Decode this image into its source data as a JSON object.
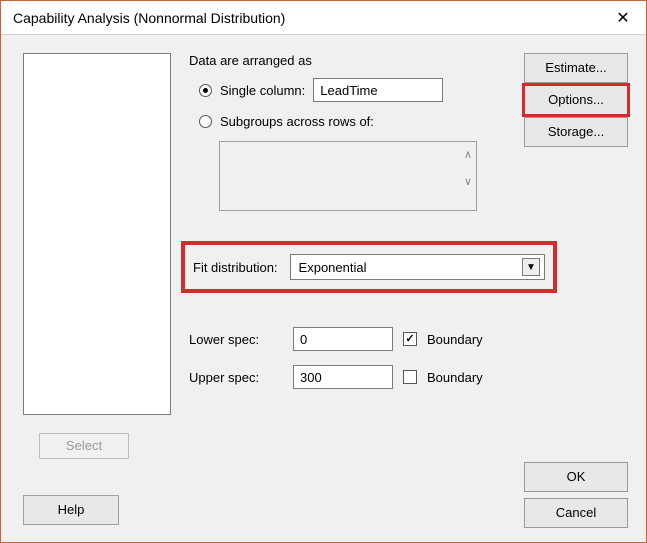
{
  "window": {
    "title": "Capability Analysis (Nonnormal Distribution)"
  },
  "buttons": {
    "estimate": "Estimate...",
    "options": "Options...",
    "storage": "Storage...",
    "select": "Select",
    "help": "Help",
    "ok": "OK",
    "cancel": "Cancel"
  },
  "form": {
    "arranged_label": "Data are arranged as",
    "single_column_label": "Single column:",
    "single_column_value": "LeadTime",
    "subgroups_label": "Subgroups across rows of:",
    "fit_label": "Fit distribution:",
    "fit_value": "Exponential",
    "lower_spec_label": "Lower spec:",
    "lower_spec_value": "0",
    "upper_spec_label": "Upper spec:",
    "upper_spec_value": "300",
    "boundary_label": "Boundary"
  }
}
